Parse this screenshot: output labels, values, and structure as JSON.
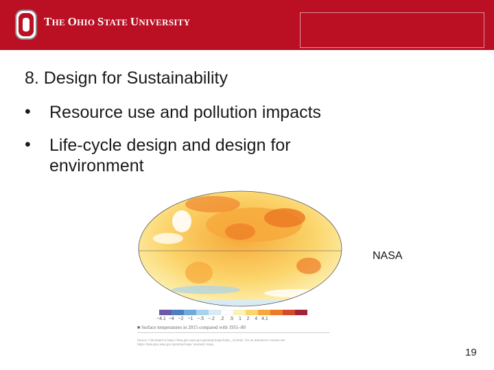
{
  "header": {
    "university_name_first": "T",
    "university_name_rest": "HE ",
    "university_o": "O",
    "university_hio": "HIO ",
    "university_s": "S",
    "university_tate": "TATE ",
    "university_u": "U",
    "university_niversity": "NIVERSITY",
    "brand_color": "#bb0f23"
  },
  "slide": {
    "heading": "8. Design for Sustainability",
    "bullets": [
      {
        "marker": "•",
        "text": "Resource use and pollution impacts"
      },
      {
        "marker": "•",
        "text": "Life-cycle design and design for environment"
      }
    ],
    "image_credit": "NASA",
    "page_number": "19"
  },
  "figure": {
    "legend_ticks": [
      "−4.1",
      "−4",
      "−2",
      "−1",
      "−.5",
      "−.2",
      ".2",
      ".5",
      "1",
      "2",
      "4",
      "4.1"
    ],
    "legend_colors": [
      "#6a5aa8",
      "#4f7fc0",
      "#6faad8",
      "#a9d3ec",
      "#d8ebf5",
      "#ffffff",
      "#fdf2b5",
      "#fbd46a",
      "#f6a83a",
      "#ec7a26",
      "#d6492a",
      "#a3243a"
    ],
    "caption": "Surface temperatures in 2015 compared with 1951–80",
    "source": "Source: Calculated at https://data.giss.nasa.gov/gistemp/maps/index_v4.html ; for an interactive version see https://data.giss.nasa.gov/gistemp/maps/ anomaly maps."
  }
}
